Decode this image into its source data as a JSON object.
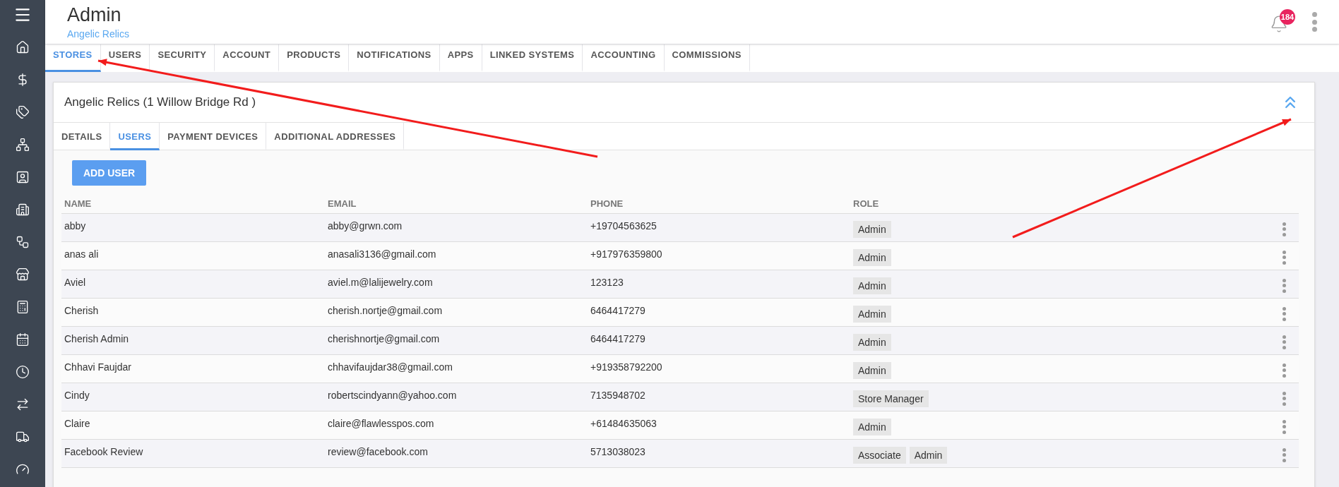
{
  "header": {
    "title": "Admin",
    "subtitle": "Angelic Relics",
    "notification_count": "184"
  },
  "tabs": [
    {
      "label": "STORES",
      "selected": true
    },
    {
      "label": "USERS",
      "selected": false
    },
    {
      "label": "SECURITY",
      "selected": false
    },
    {
      "label": "ACCOUNT",
      "selected": false
    },
    {
      "label": "PRODUCTS",
      "selected": false
    },
    {
      "label": "NOTIFICATIONS",
      "selected": false
    },
    {
      "label": "APPS",
      "selected": false
    },
    {
      "label": "LINKED SYSTEMS",
      "selected": false
    },
    {
      "label": "ACCOUNTING",
      "selected": false
    },
    {
      "label": "COMMISSIONS",
      "selected": false
    }
  ],
  "store": {
    "title": "Angelic Relics (1 Willow Bridge Rd )",
    "tabs": [
      {
        "label": "DETAILS",
        "selected": false
      },
      {
        "label": "USERS",
        "selected": true
      },
      {
        "label": "PAYMENT DEVICES",
        "selected": false
      },
      {
        "label": "ADDITIONAL ADDRESSES",
        "selected": false
      }
    ],
    "add_button": "ADD USER",
    "table": {
      "columns": [
        "NAME",
        "EMAIL",
        "PHONE",
        "ROLE"
      ],
      "rows": [
        {
          "name": "abby",
          "email": "abby@grwn.com",
          "phone": "+19704563625",
          "roles": [
            "Admin"
          ]
        },
        {
          "name": "anas ali",
          "email": "anasali3136@gmail.com",
          "phone": "+917976359800",
          "roles": [
            "Admin"
          ]
        },
        {
          "name": "Aviel",
          "email": "aviel.m@lalijewelry.com",
          "phone": "123123",
          "roles": [
            "Admin"
          ]
        },
        {
          "name": "Cherish",
          "email": "cherish.nortje@gmail.com",
          "phone": "6464417279",
          "roles": [
            "Admin"
          ]
        },
        {
          "name": "Cherish Admin",
          "email": "cherishnortje@gmail.com",
          "phone": "6464417279",
          "roles": [
            "Admin"
          ]
        },
        {
          "name": "Chhavi Faujdar",
          "email": "chhavifaujdar38@gmail.com",
          "phone": "+919358792200",
          "roles": [
            "Admin"
          ]
        },
        {
          "name": "Cindy",
          "email": "robertscindyann@yahoo.com",
          "phone": "7135948702",
          "roles": [
            "Store Manager"
          ]
        },
        {
          "name": "Claire",
          "email": "claire@flawlesspos.com",
          "phone": "+61484635063",
          "roles": [
            "Admin"
          ]
        },
        {
          "name": "Facebook Review",
          "email": "review@facebook.com",
          "phone": "5713038023",
          "roles": [
            "Associate",
            "Admin"
          ]
        }
      ]
    }
  }
}
